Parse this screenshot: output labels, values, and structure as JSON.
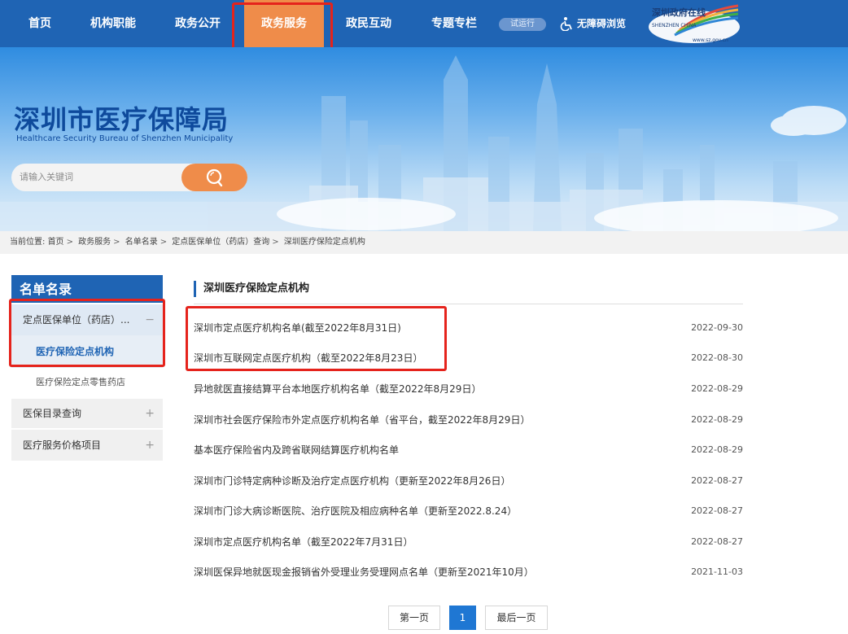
{
  "nav": {
    "items": [
      {
        "label": "首页"
      },
      {
        "label": "机构职能"
      },
      {
        "label": "政务公开"
      },
      {
        "label": "政务服务"
      },
      {
        "label": "政民互动"
      },
      {
        "label": "专题专栏"
      }
    ],
    "active": "政务服务",
    "trial_badge": "试运行",
    "accessibility": "无障碍浏览",
    "logo": {
      "text_cn": "深圳政府在线",
      "text_en": "SHENZHEN CHINA",
      "url_text": "www.sz.gov.cn"
    }
  },
  "banner": {
    "title": "深圳市医疗保障局",
    "subtitle": "Healthcare Security Bureau of Shenzhen Municipality",
    "search_placeholder": "请输入关键词"
  },
  "breadcrumb": {
    "label": "当前位置:",
    "items": [
      "首页",
      "政务服务",
      "名单名录",
      "定点医保单位（药店）查询",
      "深圳医疗保险定点机构"
    ]
  },
  "sidebar": {
    "title": "名单名录",
    "groups": [
      {
        "label": "定点医保单位（药店）...",
        "expanded": true,
        "children": [
          {
            "label": "医疗保险定点机构",
            "selected": true
          },
          {
            "label": "医疗保险定点零售药店",
            "selected": false
          }
        ]
      },
      {
        "label": "医保目录查询",
        "expanded": false
      },
      {
        "label": "医疗服务价格项目",
        "expanded": false
      }
    ]
  },
  "main": {
    "section_title": "深圳医疗保险定点机构",
    "items": [
      {
        "title": "深圳市定点医疗机构名单(截至2022年8月31日)",
        "date": "2022-09-30"
      },
      {
        "title": "深圳市互联网定点医疗机构（截至2022年8月23日）",
        "date": "2022-08-30"
      },
      {
        "title": "异地就医直接结算平台本地医疗机构名单（截至2022年8月29日）",
        "date": "2022-08-29"
      },
      {
        "title": "深圳市社会医疗保险市外定点医疗机构名单（省平台，截至2022年8月29日）",
        "date": "2022-08-29"
      },
      {
        "title": "基本医疗保险省内及跨省联网结算医疗机构名单",
        "date": "2022-08-29"
      },
      {
        "title": "深圳市门诊特定病种诊断及治疗定点医疗机构（更新至2022年8月26日）",
        "date": "2022-08-27"
      },
      {
        "title": "深圳市门诊大病诊断医院、治疗医院及相应病种名单（更新至2022.8.24）",
        "date": "2022-08-27"
      },
      {
        "title": "深圳市定点医疗机构名单（截至2022年7月31日）",
        "date": "2022-08-27"
      },
      {
        "title": "深圳医保异地就医现金报销省外受理业务受理网点名单（更新至2021年10月）",
        "date": "2021-11-03"
      }
    ]
  },
  "pager": {
    "first": "第一页",
    "current": "1",
    "last": "最后一页"
  },
  "colors": {
    "nav_blue": "#1f64b4",
    "accent_orange": "#ef8c4a",
    "highlight_red": "#e5231c",
    "pager_blue": "#1f77d3"
  }
}
